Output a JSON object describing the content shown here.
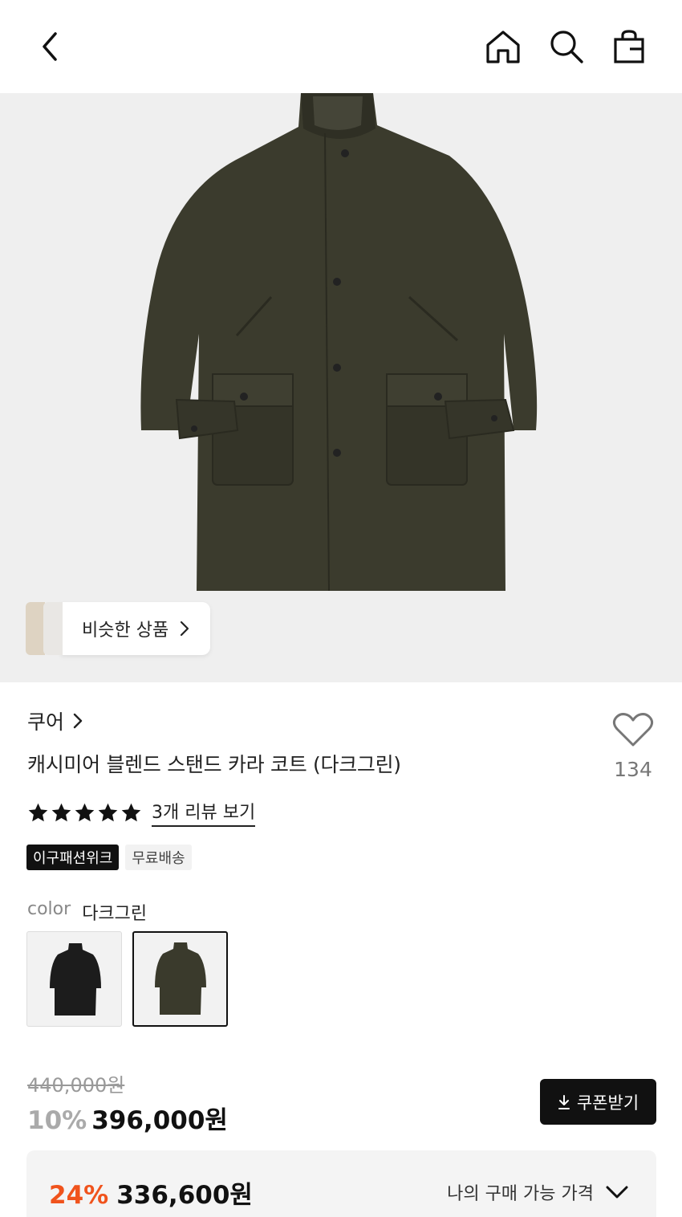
{
  "header": {
    "icons": [
      "chevron-left-icon",
      "home-icon",
      "search-icon",
      "shopping-bag-icon"
    ]
  },
  "hero": {
    "similar_label": "비슷한 상품"
  },
  "product": {
    "brand": "쿠어",
    "title": "캐시미어 블렌드 스탠드 카라 코트 (다크그린)",
    "likes": "134",
    "rating_stars": 5,
    "review_link": "3개 리뷰 보기",
    "badges": [
      "이구패션위크",
      "무료배송"
    ],
    "color_label": "color",
    "color_value": "다크그린",
    "swatches": [
      {
        "name": "black",
        "color": "#1c1c1c"
      },
      {
        "name": "dark-green",
        "color": "#3a3a2c"
      }
    ]
  },
  "price": {
    "original": "440,000원",
    "discount_pct": "10%",
    "sale": "396,000원",
    "coupon_label": "쿠폰받기"
  },
  "best_price": {
    "discount_pct": "24%",
    "amount": "336,600원",
    "label": "나의 구매 가능 가격"
  },
  "colors": {
    "accent": "#f0531c",
    "coat": "#3b3b2d",
    "dark": "#111111"
  }
}
